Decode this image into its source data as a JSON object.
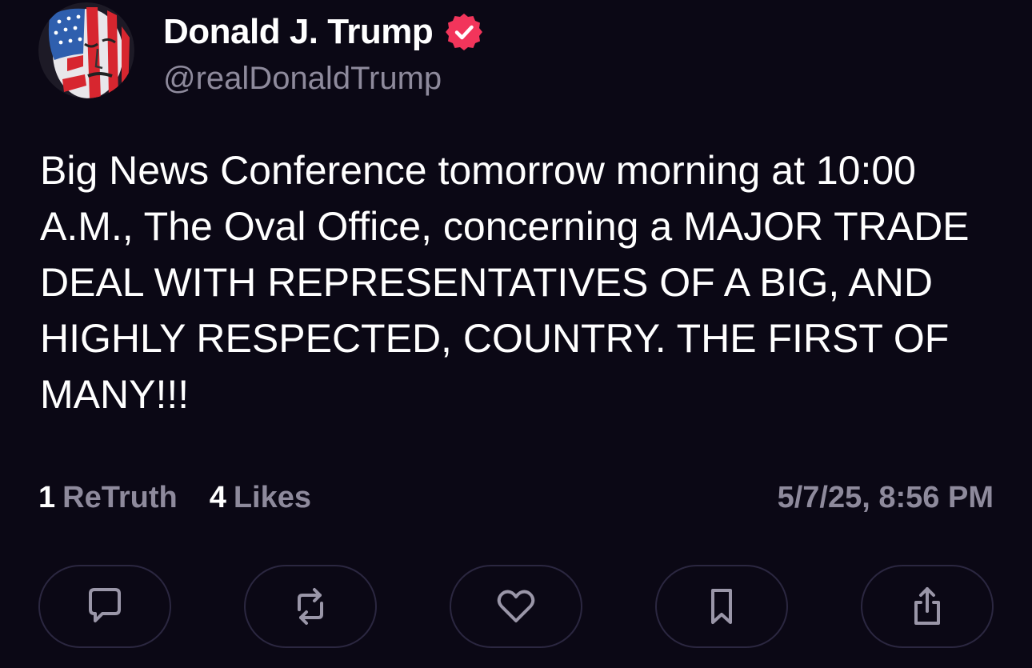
{
  "author": {
    "display_name": "Donald J. Trump",
    "handle": "@realDonaldTrump",
    "verified": true,
    "verified_badge_color": "#f2355b",
    "avatar_icon": "avatar-flag-portrait"
  },
  "post": {
    "text": "Big News Conference tomorrow morning at 10:00 A.M., The Oval Office, concerning a MAJOR TRADE DEAL WITH REPRESENTATIVES OF A BIG, AND HIGHLY RESPECTED, COUNTRY. THE FIRST OF MANY!!!"
  },
  "stats": {
    "retruths_count": "1",
    "retruths_label": "ReTruth",
    "likes_count": "4",
    "likes_label": "Likes",
    "timestamp": "5/7/25, 8:56 PM"
  },
  "actions": [
    {
      "icon": "comment-icon"
    },
    {
      "icon": "retruth-icon"
    },
    {
      "icon": "heart-icon"
    },
    {
      "icon": "bookmark-icon"
    },
    {
      "icon": "share-icon"
    }
  ],
  "colors": {
    "background": "#0b0815",
    "text_primary": "#ffffff",
    "text_secondary": "#8e8a9c",
    "button_border": "#2b2740",
    "icon_color": "#9a96a8"
  }
}
